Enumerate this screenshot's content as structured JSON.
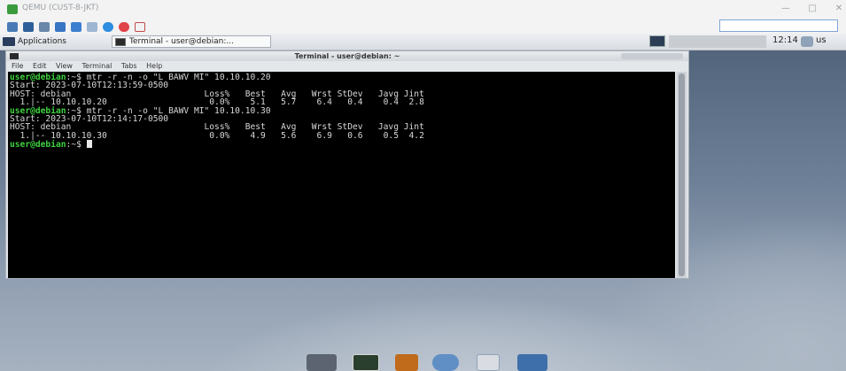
{
  "host_window": {
    "title": "QEMU (CUST-8-JKT)",
    "controls": {
      "minimize": "—",
      "maximize": "□",
      "close": "✕"
    }
  },
  "guest_panel": {
    "applications_label": "Applications",
    "task_label": "Terminal - user@debian:...",
    "clock": "12:14",
    "user_label": "us"
  },
  "terminal": {
    "title": "Terminal - user@debian: ~",
    "menu": [
      "File",
      "Edit",
      "View",
      "Terminal",
      "Tabs",
      "Help"
    ],
    "prompt": "user@debian:~$",
    "lines": [
      {
        "prompt": "user@debian",
        "rest": ":~$ mtr -r -n -o \"L BAWV MI\" 10.10.10.20"
      },
      {
        "text": "Start: 2023-07-10T12:13:59-0500"
      },
      {
        "text": "HOST: debian                          Loss%   Best   Avg   Wrst StDev   Javg Jint"
      },
      {
        "text": "  1.|-- 10.10.10.20                    0.0%    5.1   5.7    6.4   0.4    0.4  2.8"
      },
      {
        "prompt": "user@debian",
        "rest": ":~$ mtr -r -n -o \"L BAWV MI\" 10.10.10.30"
      },
      {
        "text": "Start: 2023-07-10T12:14:17-0500"
      },
      {
        "text": "HOST: debian                          Loss%   Best   Avg   Wrst StDev   Javg Jint"
      },
      {
        "text": "  1.|-- 10.10.10.30                    0.0%    4.9   5.6    6.9   0.6    0.5  4.2"
      },
      {
        "prompt": "user@debian",
        "rest": ":~$ ",
        "cursor": true
      }
    ]
  },
  "colors": {
    "prompt": "#3fd13f",
    "terminal_bg": "#000000",
    "terminal_fg": "#d8d8d8"
  },
  "dock_icons": [
    "drive-icon",
    "terminal-icon",
    "file-manager-icon",
    "web-browser-icon",
    "search-icon",
    "folder-icon"
  ]
}
